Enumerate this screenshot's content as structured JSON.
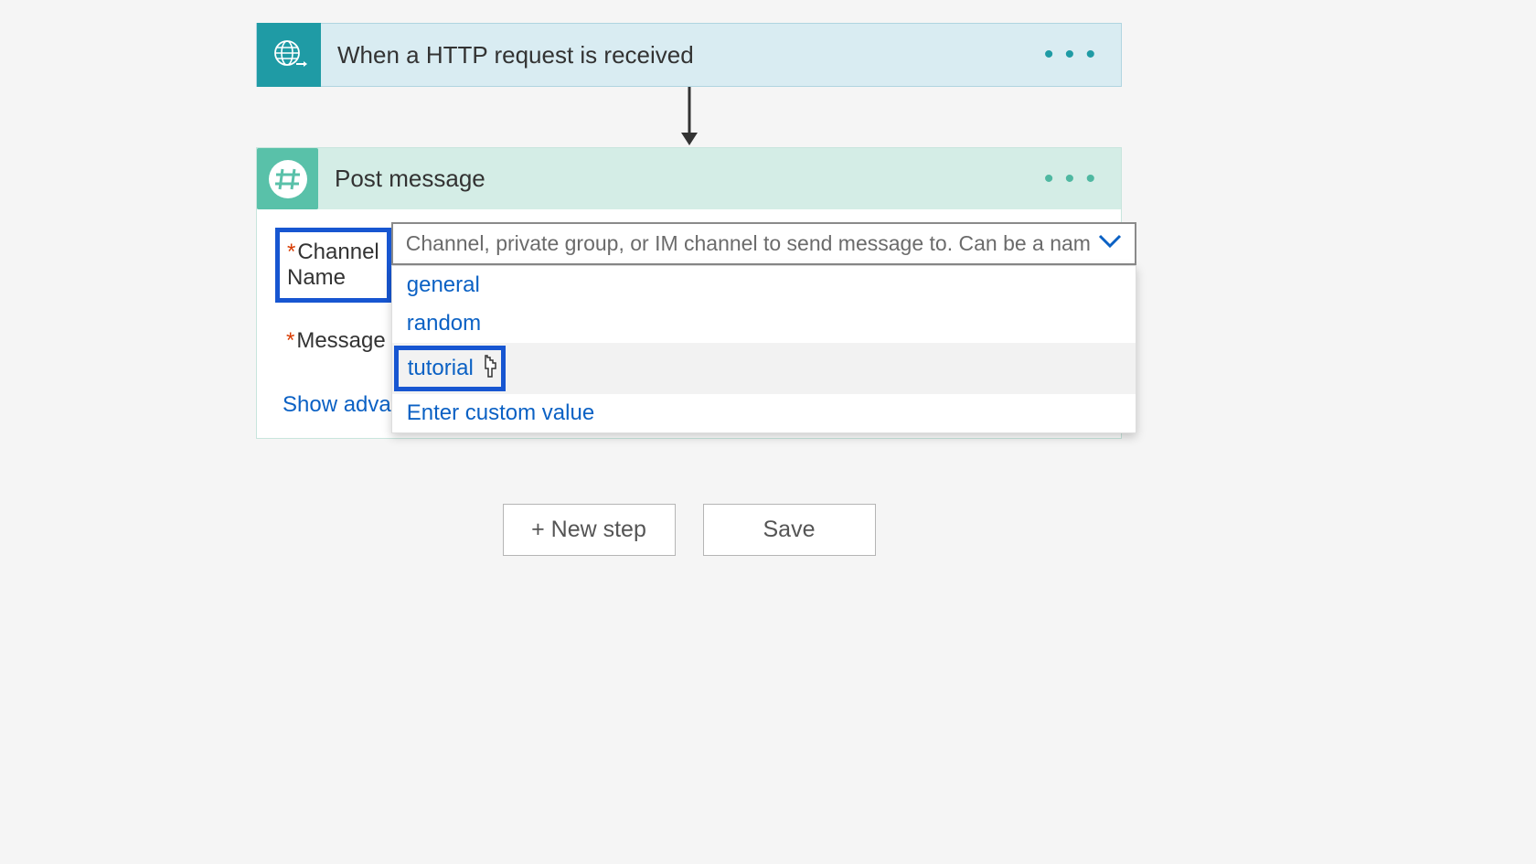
{
  "trigger": {
    "title": "When a HTTP request is received"
  },
  "action": {
    "title": "Post message",
    "fields": {
      "channel_name": {
        "label": "Channel Name",
        "placeholder": "Channel, private group, or IM channel to send message to. Can be a nam"
      },
      "message_text": {
        "label": "Message Text"
      }
    },
    "dropdown_options": [
      "general",
      "random",
      "tutorial"
    ],
    "custom_value_label": "Enter custom value",
    "advanced_link": "Show advanced options"
  },
  "buttons": {
    "new_step": "+ New step",
    "save": "Save"
  }
}
